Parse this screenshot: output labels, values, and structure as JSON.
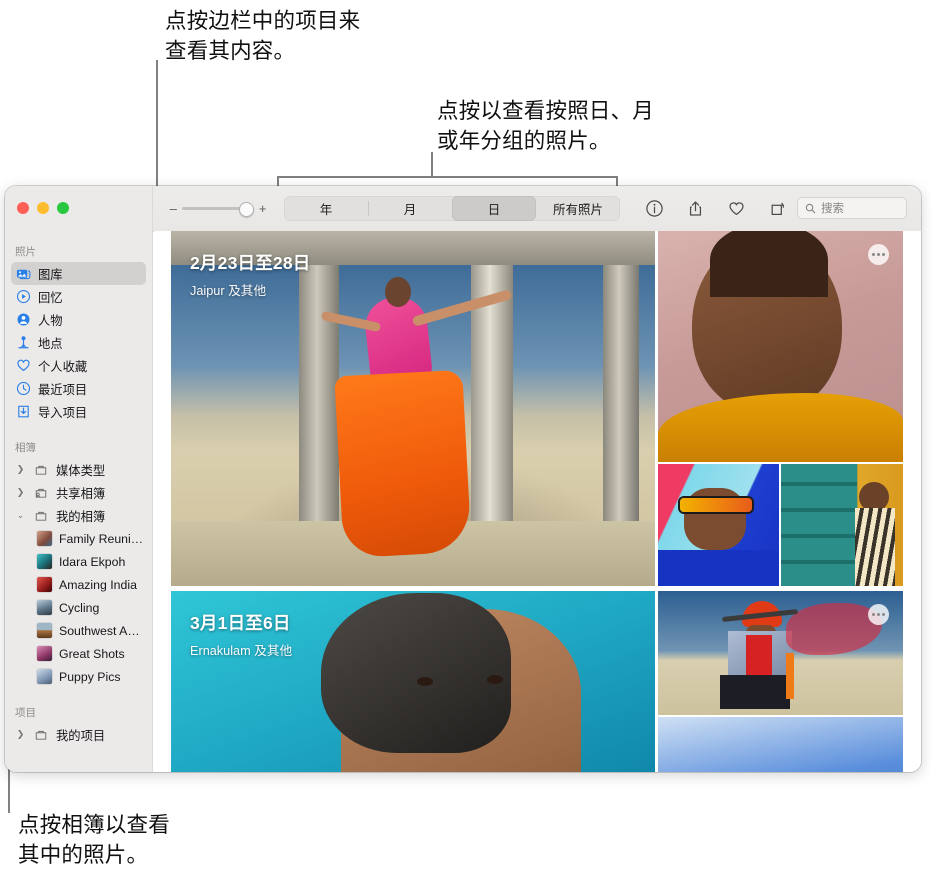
{
  "callouts": [
    {
      "name": "sidebar-callout",
      "text": "点按边栏中的项目来\n查看其内容。"
    },
    {
      "name": "view-mode-callout",
      "text": "点按以查看按照日、月\n或年分组的照片。"
    },
    {
      "name": "album-callout",
      "text": "点按相簿以查看\n其中的照片。"
    }
  ],
  "window": {
    "traffic_lights": {
      "close": "close-button",
      "minimize": "minimize-button",
      "zoom": "maximize-button"
    },
    "zoom_slider": {
      "minus": "–",
      "plus": "+",
      "value": 80
    },
    "segmented": {
      "options": [
        "年",
        "月",
        "日",
        "所有照片"
      ],
      "selected": "日"
    },
    "toolbar_icons": [
      "info-icon",
      "share-icon",
      "favorite-icon",
      "rotate-icon"
    ],
    "search": {
      "placeholder": "搜索",
      "value": ""
    }
  },
  "sidebar": {
    "sections": [
      {
        "title": "照片",
        "items": [
          {
            "label": "图库",
            "icon": "library-icon",
            "selected": true,
            "kind": "icon"
          },
          {
            "label": "回忆",
            "icon": "memories-icon",
            "selected": false,
            "kind": "icon"
          },
          {
            "label": "人物",
            "icon": "people-icon",
            "selected": false,
            "kind": "icon"
          },
          {
            "label": "地点",
            "icon": "places-icon",
            "selected": false,
            "kind": "icon"
          },
          {
            "label": "个人收藏",
            "icon": "heart-icon",
            "selected": false,
            "kind": "icon"
          },
          {
            "label": "最近项目",
            "icon": "recents-icon",
            "selected": false,
            "kind": "icon"
          },
          {
            "label": "导入项目",
            "icon": "imports-icon",
            "selected": false,
            "kind": "icon"
          }
        ]
      },
      {
        "title": "相簿",
        "items": [
          {
            "label": "媒体类型",
            "icon": "folder-icon",
            "kind": "folder",
            "twisty": "collapsed"
          },
          {
            "label": "共享相簿",
            "icon": "shared-folder-icon",
            "kind": "folder",
            "twisty": "collapsed"
          },
          {
            "label": "我的相簿",
            "icon": "folder-icon",
            "kind": "folder",
            "twisty": "expanded"
          },
          {
            "label": "Family Reuni…",
            "kind": "album",
            "thumb": "#c08a76"
          },
          {
            "label": "Idara Ekpoh",
            "kind": "album",
            "thumb": "#2fa3a8"
          },
          {
            "label": "Amazing India",
            "kind": "album",
            "thumb": "#b32a2a"
          },
          {
            "label": "Cycling",
            "kind": "album",
            "thumb": "#8fa5b8"
          },
          {
            "label": "Southwest A…",
            "kind": "album",
            "thumb": "#8d6a4e"
          },
          {
            "label": "Great Shots",
            "kind": "album",
            "thumb": "#a2527c"
          },
          {
            "label": "Puppy Pics",
            "kind": "album",
            "thumb": "#9fb6cf"
          }
        ]
      },
      {
        "title": "项目",
        "items": [
          {
            "label": "我的项目",
            "icon": "folder-icon",
            "kind": "folder",
            "twisty": "collapsed"
          }
        ]
      }
    ]
  },
  "photo_groups": [
    {
      "date": "2月23日至28日",
      "place": "Jaipur 及其他",
      "has_more_button": true
    },
    {
      "date": "3月1日至6日",
      "place": "Ernakulam 及其他",
      "has_more_button": true
    }
  ]
}
